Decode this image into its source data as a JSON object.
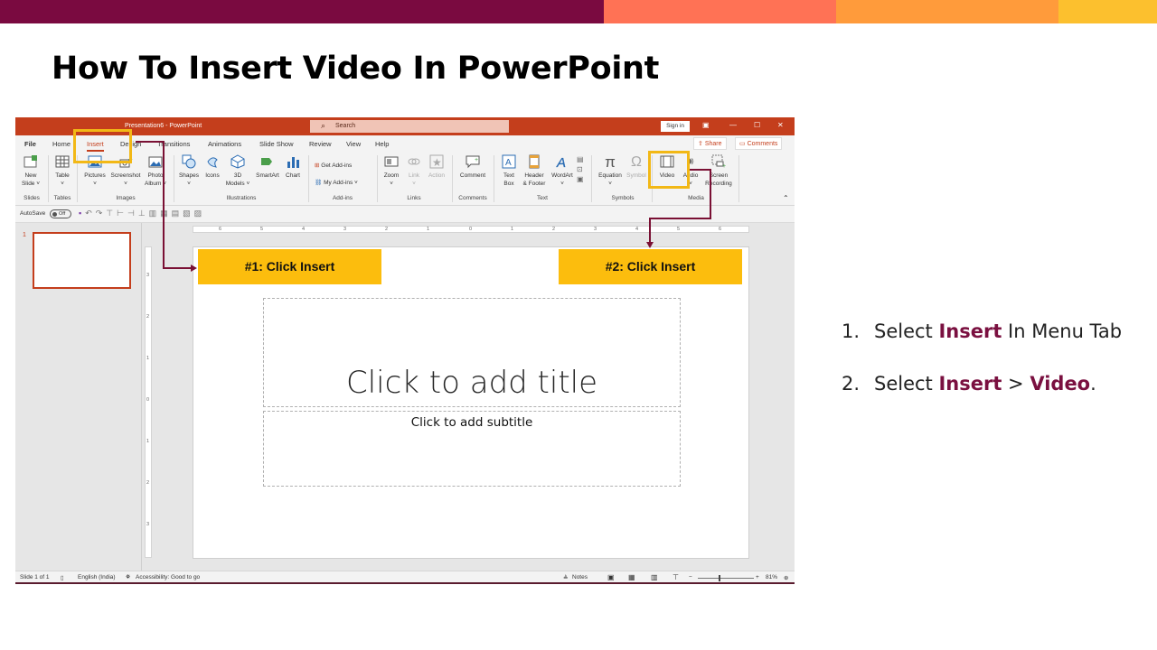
{
  "top_bar": {
    "colors": [
      "#7a0a40",
      "#ff7255",
      "#ff9b3b",
      "#fcc02e"
    ]
  },
  "slide": {
    "title": "How To Insert Video In PowerPoint"
  },
  "window": {
    "title": "Presentation6 - PowerPoint",
    "search_placeholder": "Search",
    "sign_in": "Sign in",
    "menu": [
      "File",
      "Home",
      "Insert",
      "Design",
      "Transitions",
      "Animations",
      "Slide Show",
      "Review",
      "View",
      "Help"
    ],
    "share": "Share",
    "comments": "Comments",
    "ribbon": {
      "new_slide": [
        "New",
        "Slide ˅"
      ],
      "table": [
        "Table",
        "˅"
      ],
      "pictures": [
        "Pictures",
        "˅"
      ],
      "screenshot": [
        "Screenshot",
        "˅"
      ],
      "photo_album": [
        "Photo",
        "Album ˅"
      ],
      "shapes": [
        "Shapes",
        "˅"
      ],
      "icons": "Icons",
      "models": [
        "3D",
        "Models ˅"
      ],
      "smartart": "SmartArt",
      "chart": "Chart",
      "get_addins": "Get Add-ins",
      "my_addins": "My Add-ins",
      "zoom": [
        "Zoom",
        "˅"
      ],
      "link": [
        "Link",
        "˅"
      ],
      "action": "Action",
      "comment": "Comment",
      "text_box": [
        "Text",
        "Box"
      ],
      "header_footer": [
        "Header",
        "& Footer"
      ],
      "wordart": [
        "WordArt",
        "˅"
      ],
      "equation": [
        "Equation",
        "˅"
      ],
      "symbol": "Symbol",
      "video": "Video",
      "audio": [
        "Audio",
        "˅"
      ],
      "screen_recording": [
        "Screen",
        "Recording"
      ],
      "groups": [
        "Slides",
        "Tables",
        "Images",
        "Illustrations",
        "Add-ins",
        "Links",
        "Comments",
        "Text",
        "Symbols",
        "Media"
      ]
    },
    "qat": {
      "autosave": "AutoSave",
      "toggle": "Off"
    },
    "thumbnail_number": "1",
    "ruler_h": [
      "6",
      "5",
      "4",
      "3",
      "2",
      "1",
      "0",
      "1",
      "2",
      "3",
      "4",
      "5",
      "6"
    ],
    "ruler_v": [
      "3",
      "2",
      "1",
      "0",
      "1",
      "2",
      "3"
    ],
    "placeholder_title": "Click to add title",
    "placeholder_subtitle": "Click to add subtitle",
    "status": {
      "slide_of": "Slide 1 of 1",
      "language": "English (India)",
      "accessibility": "Accessibility: Good to go",
      "notes": "Notes",
      "zoom": "81%"
    }
  },
  "callouts": {
    "one": "#1: Click Insert",
    "two": "#2: Click Insert"
  },
  "steps": [
    {
      "num": "1.",
      "pre": "Select ",
      "b1": "Insert",
      "mid": " In Menu Tab",
      "b2": "",
      "post": ""
    },
    {
      "num": "2.",
      "pre": "Select ",
      "b1": "Insert",
      "mid": " > ",
      "b2": "Video",
      "post": "."
    }
  ]
}
